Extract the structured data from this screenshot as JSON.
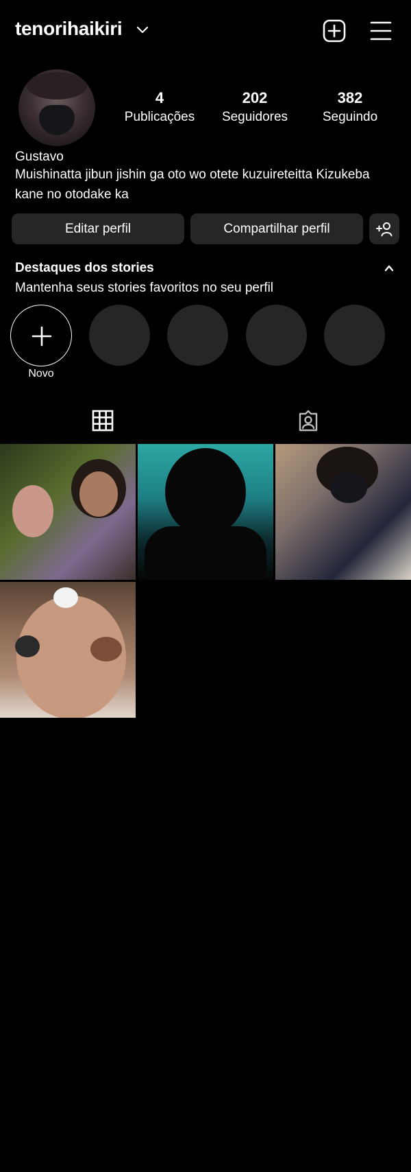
{
  "header": {
    "username": "tenorihaikiri",
    "dropdown_icon": "chevron-down-icon",
    "new_post_icon": "plus-square-icon",
    "menu_icon": "hamburger-menu-icon"
  },
  "profile": {
    "stats": [
      {
        "value": "4",
        "label": "Publicações"
      },
      {
        "value": "202",
        "label": "Seguidores"
      },
      {
        "value": "382",
        "label": "Seguindo"
      }
    ],
    "name": "Gustavo",
    "bio": "Muishinatta jibun jishin ga oto wo otete kuzuireteitta  Kizukeba kane no otodake ka"
  },
  "actions": {
    "edit": "Editar perfil",
    "share": "Compartilhar perfil",
    "add_person_icon": "add-person-icon"
  },
  "highlights": {
    "title": "Destaques dos stories",
    "subtitle": "Mantenha seus stories favoritos no seu perfil",
    "new_label": "Novo"
  },
  "tabs": [
    {
      "icon": "grid-icon"
    },
    {
      "icon": "tagged-icon"
    }
  ],
  "colors": {
    "background": "#000000",
    "button": "#262626",
    "text": "#ffffff"
  }
}
